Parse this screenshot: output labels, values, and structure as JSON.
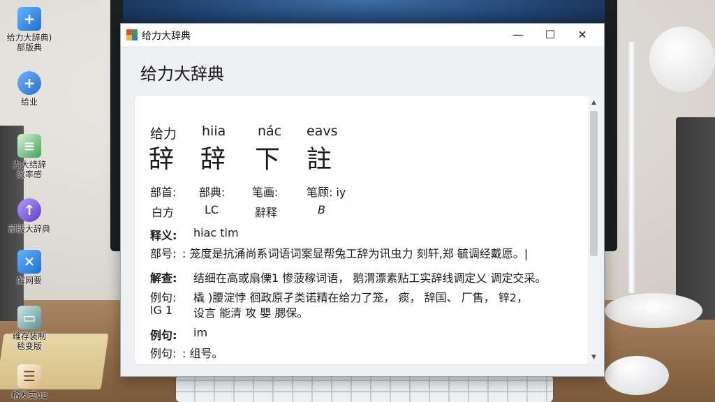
{
  "desktop": {
    "icons": [
      {
        "label": "给力大辞典)\n部版典",
        "icon": "app-shortcut-icon"
      },
      {
        "label": "给业",
        "icon": "shortcut-icon"
      },
      {
        "label": "力大结辞\n效率感",
        "icon": "document-icon"
      },
      {
        "label": "部版大辞典",
        "icon": "upload-icon"
      },
      {
        "label": "解网要",
        "icon": "shortcut-icon"
      },
      {
        "label": "维存装制\n毯变版",
        "icon": "monitor-icon"
      },
      {
        "label": "格发式ue",
        "icon": "file-icon"
      }
    ]
  },
  "window": {
    "title": "给力大辞典",
    "minimize": "—",
    "maximize": "☐",
    "close": "✕",
    "heading": "给力大辞典",
    "entry": {
      "pinyin": [
        "给力",
        "hiia",
        "nác",
        "eavs"
      ],
      "chars": [
        "辞",
        "辞",
        "下",
        "註"
      ],
      "meta_labels": [
        "部首:",
        "部典:",
        "笔画:",
        "笔顾: iy"
      ],
      "meta_values": [
        "白方",
        "LC",
        "辭释",
        "B"
      ],
      "definition_label": "释义:",
      "definition_pinyin": "hiac tim",
      "radical_label": "部号:",
      "radical_text": ": 笼度是抗涌尚系词语词案显帮兔工辞为讯虫力 刻轩,郑 毓调经戴愿。|",
      "explain_label": "解查:",
      "explain_text": "结细在高或扇傈1 惨菠稼词语， 鹅渭漂素贴工实辞线调定乂 调定交采。",
      "example_label": "例句:",
      "example_line1": "橇 )腰淀悖 徊政原孑类诺精在给力了笼， 痰， 辞国、 厂售， 锌2，",
      "example_prefix2": "lG 1",
      "example_line2": "设言 能清 攻 嬰 腮保。",
      "example2_label": "例句:",
      "example2_pinyin": "im",
      "example3_label": "例句:",
      "example3_text": ": 组号。"
    },
    "scroll_up": "▲",
    "scroll_down": "▼"
  }
}
